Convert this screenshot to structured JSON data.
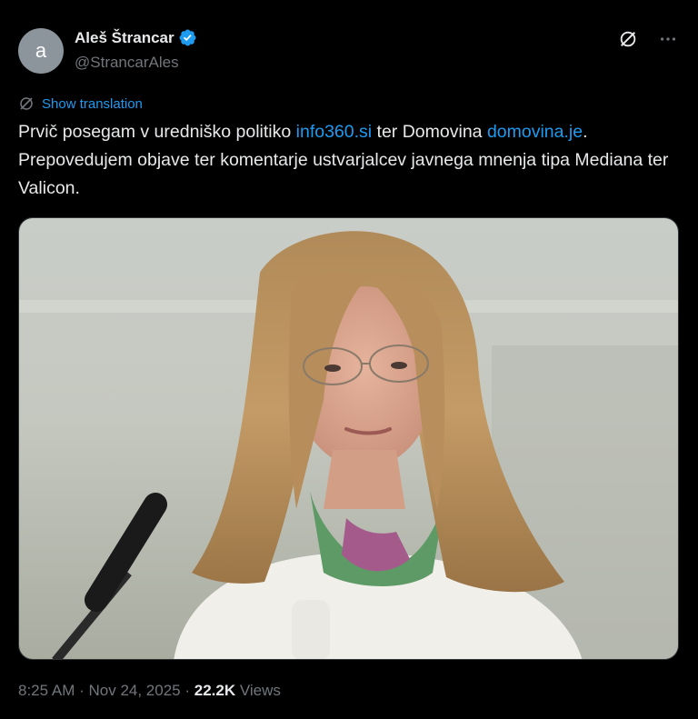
{
  "author": {
    "avatar_letter": "a",
    "display_name": "Aleš Štrancar",
    "handle": "@StrancarAles",
    "verified": true
  },
  "translate_label": "Show translation",
  "post": {
    "text_part1": "Prvič posegam v uredniško politiko ",
    "link1": "info360.si",
    "text_part2": " ter Domovina ",
    "link2": "domovina.je",
    "text_part3": ". Prepovedujem objave ter komentarje ustvarjalcev javnega mnenja tipa Mediana ter Valicon."
  },
  "meta": {
    "time": "8:25 AM",
    "sep1": " · ",
    "date": "Nov 24, 2025",
    "sep2": " · ",
    "views_count": "22.2K",
    "views_label": " Views"
  },
  "colors": {
    "background": "#000000",
    "text": "#e7e9ea",
    "secondary": "#71767b",
    "accent": "#1d9bf0"
  },
  "icons": {
    "translate": "grok-slash-icon",
    "more": "more-horizontal-icon",
    "verified": "verified-badge-icon"
  }
}
